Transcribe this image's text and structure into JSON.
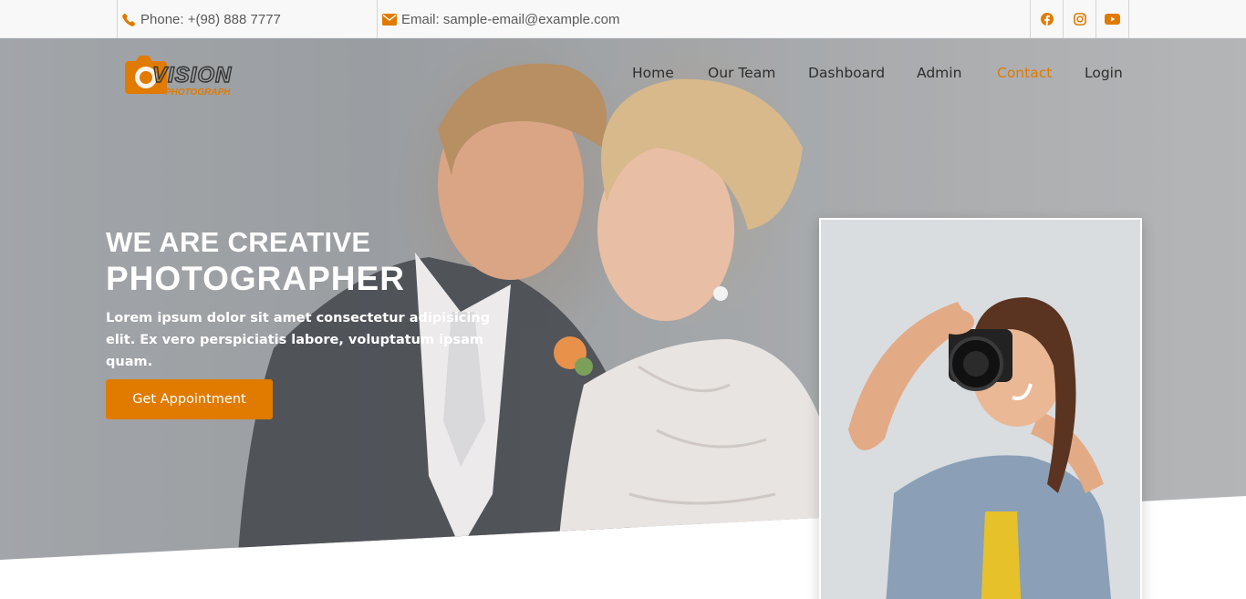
{
  "topbar": {
    "phone": "Phone: +(98) 888 7777",
    "email": "Email: sample-email@example.com",
    "social": [
      {
        "icon": "facebook-icon"
      },
      {
        "icon": "instagram-icon"
      },
      {
        "icon": "youtube-icon"
      }
    ]
  },
  "brand": {
    "logo_text": "VISION",
    "logo_subtext": "PHOTOGRAPH",
    "accent_color": "#e07b00"
  },
  "nav": {
    "items": [
      "Home",
      "Our Team",
      "Dashboard",
      "Admin",
      "Contact",
      "Login"
    ],
    "active": "Contact"
  },
  "hero": {
    "title_line1": "WE ARE CREATIVE",
    "title_line2": "PHOTOGRAPHER",
    "description": "Lorem ipsum dolor sit amet consectetur adipisicing elit. Ex vero perspiciatis labore, voluptatum ipsam quam.",
    "cta_label": "Get Appointment"
  }
}
